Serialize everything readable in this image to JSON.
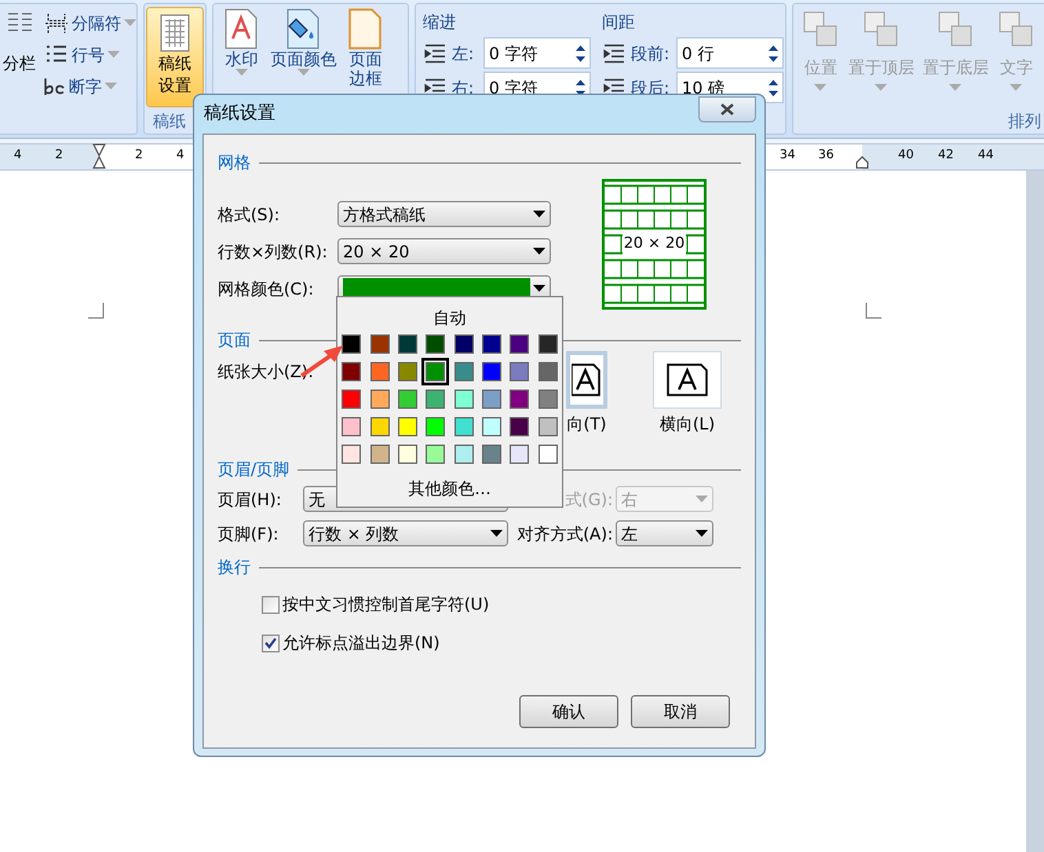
{
  "ribbon": {
    "columns_button": {
      "label": "分栏"
    },
    "small_buttons": [
      {
        "label": "分隔符"
      },
      {
        "label": "行号"
      },
      {
        "label": "断字"
      }
    ],
    "grid_paper_button": {
      "label_lines": [
        "稿纸",
        "设置"
      ],
      "selected": true
    },
    "grid_paper_group_label": "稿纸",
    "background_buttons": [
      {
        "label_lines": [
          "水印"
        ],
        "kind": "watermark"
      },
      {
        "label_lines": [
          "页面颜色"
        ],
        "kind": "bucket"
      },
      {
        "label_lines": [
          "页面",
          "边框"
        ],
        "kind": "page"
      }
    ],
    "indent": {
      "title": "缩进",
      "fields": [
        {
          "label": "左:",
          "value": "0 字符"
        },
        {
          "label": "右:",
          "value": "0 字符"
        }
      ]
    },
    "spacing": {
      "title": "间距",
      "fields": [
        {
          "label": "段前:",
          "value": "0 行"
        },
        {
          "label": "段后:",
          "value": "10 磅"
        }
      ]
    },
    "arrange_buttons": [
      {
        "label": "位置"
      },
      {
        "label": "置于顶层"
      },
      {
        "label": "置于底层"
      },
      {
        "label": "文字"
      }
    ],
    "arrange_group_label": "排列"
  },
  "ruler": {
    "left_numbers": [
      "4",
      "2",
      "2",
      "4"
    ],
    "right_numbers": [
      "34",
      "36",
      "40",
      "42",
      "44"
    ]
  },
  "dialog": {
    "title": "稿纸设置",
    "grid": {
      "title": "网格",
      "format": {
        "label": "格式(S):",
        "value": "方格式稿纸"
      },
      "size": {
        "label": "行数×列数(R):",
        "value": "20 × 20"
      },
      "color": {
        "label": "网格颜色(C):",
        "color": "#009000"
      },
      "preview_label": "20 × 20"
    },
    "page": {
      "title": "页面",
      "paper_size_label": "纸张大小(Z):",
      "orientations": [
        {
          "label": "向(T)",
          "selected": true
        },
        {
          "label": "横向(L)",
          "selected": false
        }
      ]
    },
    "header_footer": {
      "title": "页眉/页脚",
      "header": {
        "label": "页眉(H):",
        "value": "无",
        "align_label": "式(G):",
        "align_value": "右",
        "align_disabled": true
      },
      "footer": {
        "label": "页脚(F):",
        "value": "行数 × 列数",
        "align_label": "对齐方式(A):",
        "align_value": "左",
        "align_disabled": false
      }
    },
    "line_break": {
      "title": "换行",
      "options": [
        {
          "label": "按中文习惯控制首尾字符(U)",
          "checked": false
        },
        {
          "label": "允许标点溢出边界(N)",
          "checked": true
        }
      ]
    },
    "buttons": [
      "确认",
      "取消"
    ]
  },
  "color_popup": {
    "auto_label": "自动",
    "more_label": "其他颜色…",
    "swatches": [
      {
        "color": "#000000",
        "selected": false
      },
      {
        "color": "#993300",
        "selected": false
      },
      {
        "color": "#003838",
        "selected": false
      },
      {
        "color": "#004d00",
        "selected": false
      },
      {
        "color": "#000066",
        "selected": false
      },
      {
        "color": "#000090",
        "selected": false
      },
      {
        "color": "#4b0082",
        "selected": false
      },
      {
        "color": "#262626",
        "selected": false
      },
      {
        "color": "#800000",
        "selected": false
      },
      {
        "color": "#ff6622",
        "selected": false
      },
      {
        "color": "#888800",
        "selected": false
      },
      {
        "color": "#009000",
        "selected": true
      },
      {
        "color": "#388c8c",
        "selected": false
      },
      {
        "color": "#0000ff",
        "selected": false
      },
      {
        "color": "#7b7bc0",
        "selected": false
      },
      {
        "color": "#666666",
        "selected": false
      },
      {
        "color": "#ff0000",
        "selected": false
      },
      {
        "color": "#ffaa5a",
        "selected": false
      },
      {
        "color": "#33cc33",
        "selected": false
      },
      {
        "color": "#3cb371",
        "selected": false
      },
      {
        "color": "#7fffd4",
        "selected": false
      },
      {
        "color": "#7b9fc7",
        "selected": false
      },
      {
        "color": "#800080",
        "selected": false
      },
      {
        "color": "#808080",
        "selected": false
      },
      {
        "color": "#ffc0cb",
        "selected": false
      },
      {
        "color": "#ffd700",
        "selected": false
      },
      {
        "color": "#ffff00",
        "selected": false
      },
      {
        "color": "#00ff00",
        "selected": false
      },
      {
        "color": "#40e0d0",
        "selected": false
      },
      {
        "color": "#c0ffff",
        "selected": false
      },
      {
        "color": "#480048",
        "selected": false
      },
      {
        "color": "#c0c0c0",
        "selected": false
      },
      {
        "color": "#ffe4e1",
        "selected": false
      },
      {
        "color": "#d2b48c",
        "selected": false
      },
      {
        "color": "#ffffe0",
        "selected": false
      },
      {
        "color": "#98fb98",
        "selected": false
      },
      {
        "color": "#afeeee",
        "selected": false
      },
      {
        "color": "#68838b",
        "selected": false
      },
      {
        "color": "#e6e6fa",
        "selected": false
      },
      {
        "color": "#ffffff",
        "selected": false
      }
    ]
  }
}
